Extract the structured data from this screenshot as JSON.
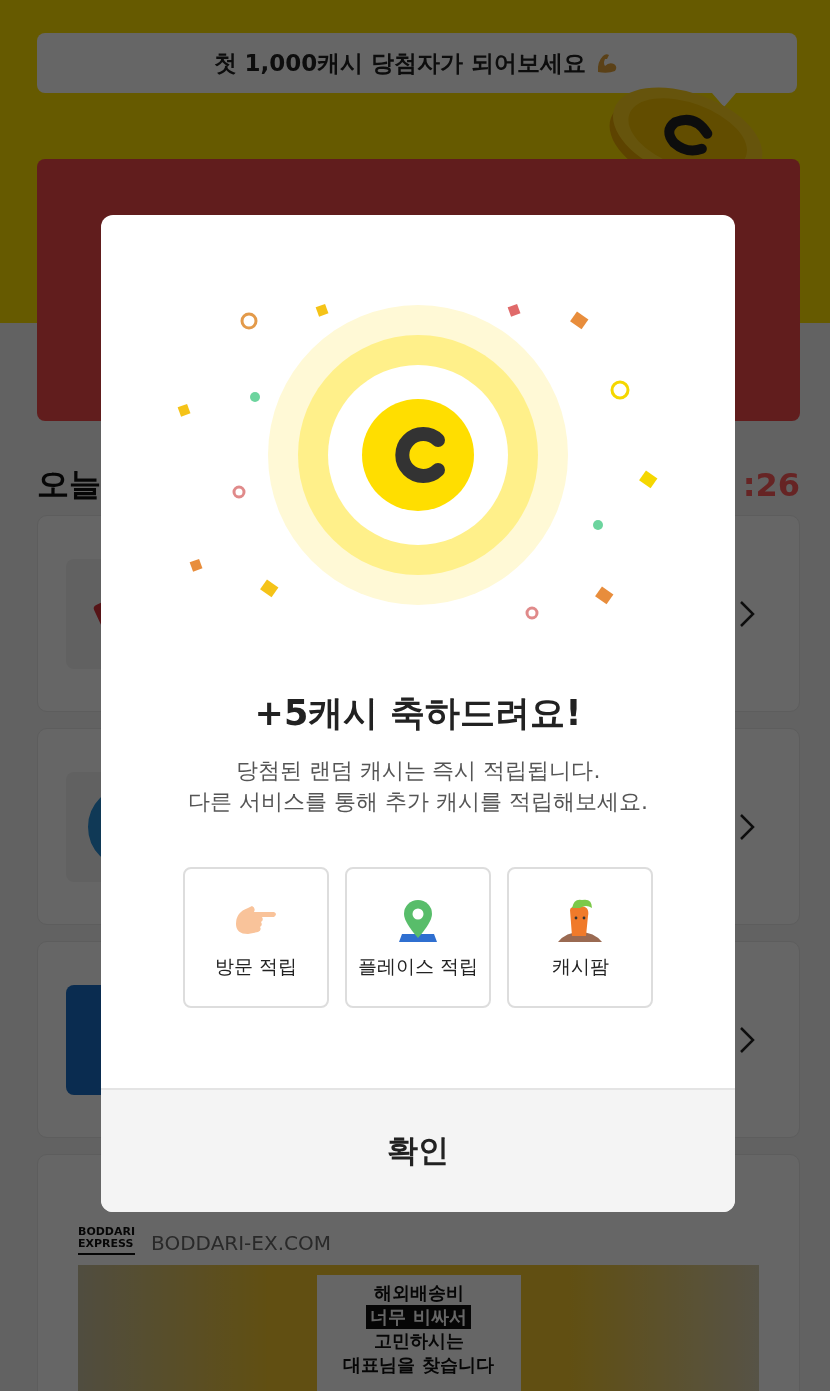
{
  "banner": {
    "text": "첫 1,000캐시 당첨자가 되어보세요"
  },
  "section": {
    "title": "오늘",
    "timer": ":26"
  },
  "offers": [
    {
      "kind": "tag"
    },
    {
      "kind": "ring"
    },
    {
      "kind": "tile"
    }
  ],
  "ad": {
    "logo_top": "BODDARI",
    "logo_bottom": "EXPRESS",
    "domain": "BODDARI-EX.COM",
    "banner_lines": [
      "해외배송비",
      "너무 비싸서",
      "고민하시는",
      "대표님을 찾습니다"
    ]
  },
  "dialog": {
    "title": "+5캐시 축하드려요!",
    "message_lines": [
      "당첨된 랜덤 캐시는 즉시 적립됩니다.",
      "다른 서비스를 통해 추가 캐시를 적립해보세요."
    ],
    "shortcuts": [
      {
        "kind": "hand",
        "label": "방문 적립"
      },
      {
        "kind": "pin",
        "label": "플레이스 적립"
      },
      {
        "kind": "carrot",
        "label": "캐시팜"
      }
    ],
    "confirm": "확인"
  }
}
